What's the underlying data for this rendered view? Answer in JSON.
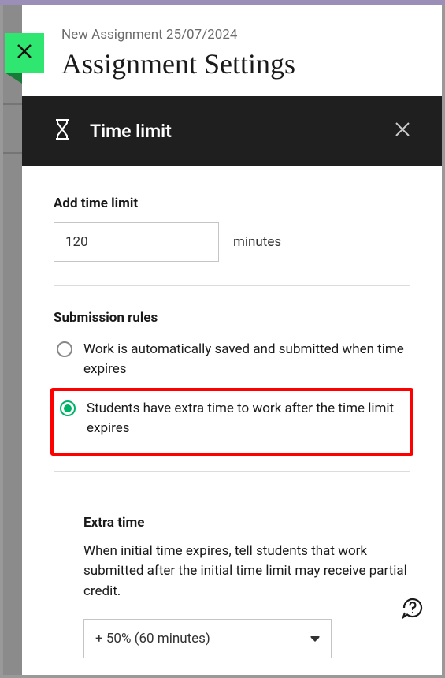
{
  "header": {
    "breadcrumb": "New Assignment 25/07/2024",
    "title": "Assignment Settings"
  },
  "section": {
    "title": "Time limit"
  },
  "timeLimit": {
    "label": "Add time limit",
    "value": "120",
    "unit": "minutes"
  },
  "submissionRules": {
    "label": "Submission rules",
    "options": [
      "Work is automatically saved and submitted when time expires",
      "Students have extra time to work after the time limit expires"
    ],
    "selectedIndex": 1
  },
  "extraTime": {
    "label": "Extra time",
    "description": "When initial time expires, tell students that work submitted after the initial time limit may receive partial credit.",
    "selected": "+ 50% (60 minutes)"
  }
}
